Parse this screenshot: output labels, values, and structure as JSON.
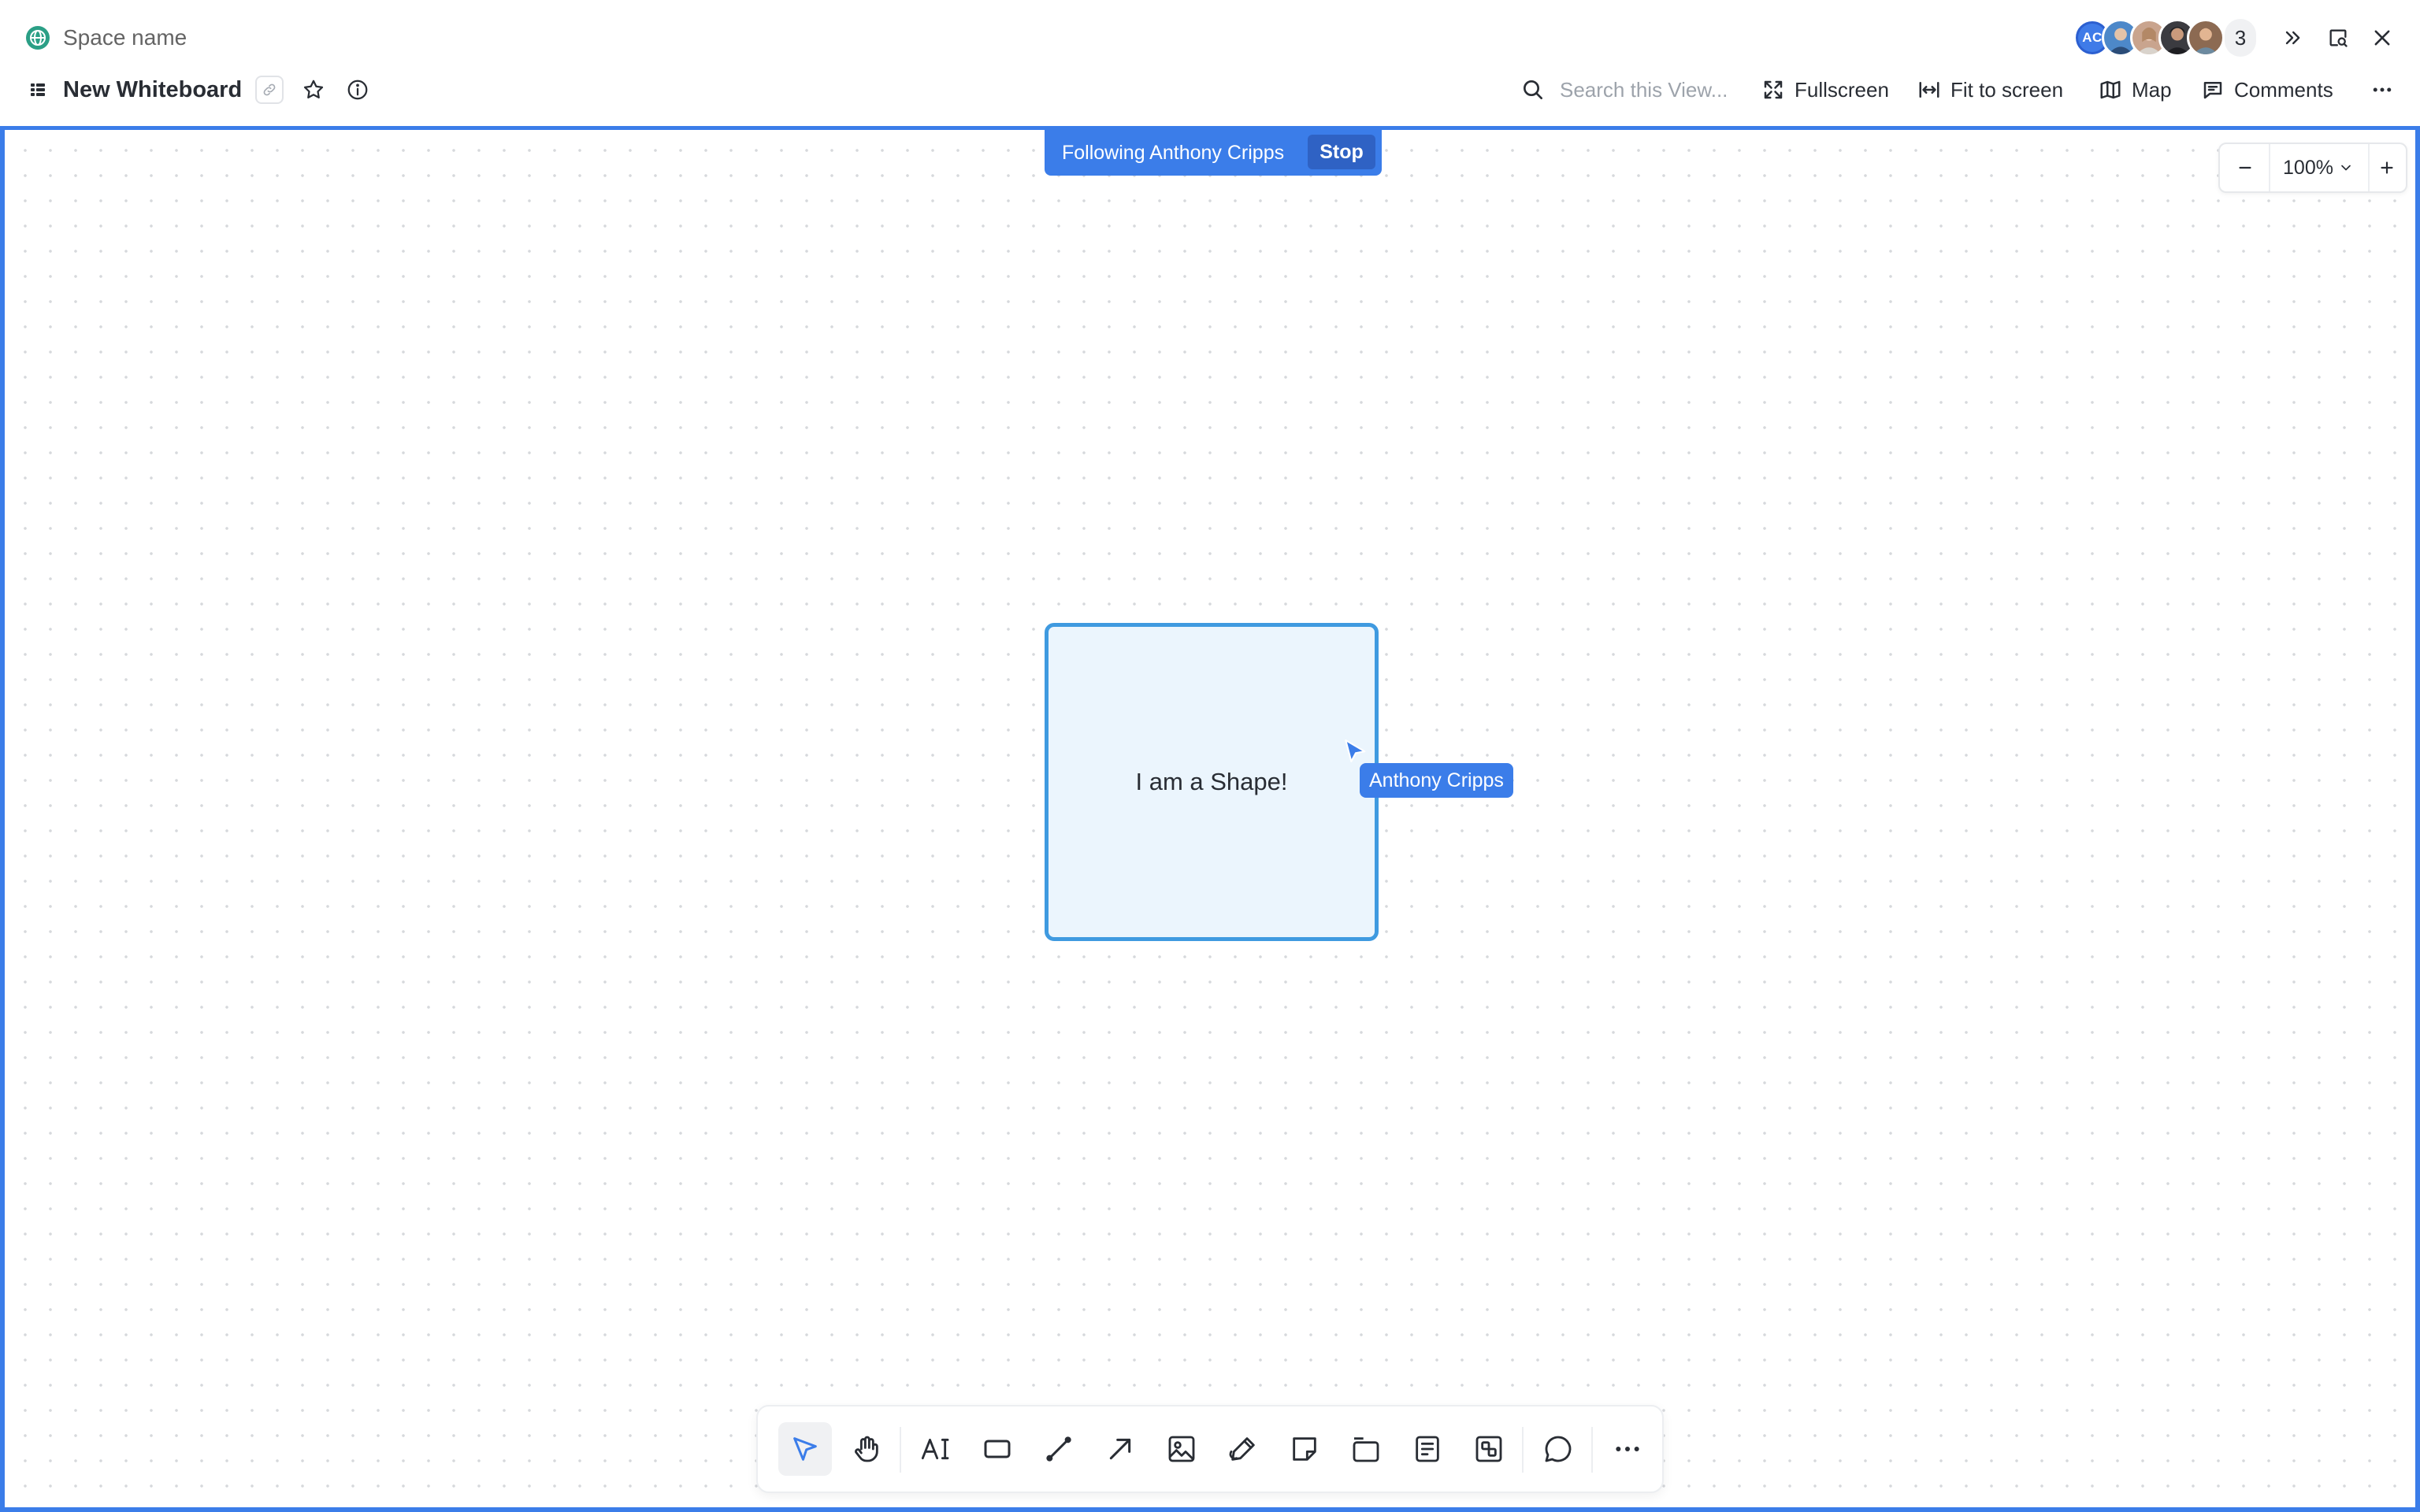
{
  "header": {
    "space_name": "Space name",
    "doc_title": "New Whiteboard",
    "avatars": [
      {
        "initials": "AC",
        "color": "#3f7be8"
      },
      {
        "initials": "",
        "color": "#4d88c9"
      },
      {
        "initials": "",
        "color": "#c9a48e"
      },
      {
        "initials": "",
        "color": "#3b3b40"
      },
      {
        "initials": "",
        "color": "#8c6a52"
      }
    ],
    "avatar_count": "3"
  },
  "toolbar": {
    "search_placeholder": "Search this View...",
    "fullscreen_label": "Fullscreen",
    "fit_label": "Fit to screen",
    "map_label": "Map",
    "comments_label": "Comments"
  },
  "canvas": {
    "follow_text": "Following Anthony Cripps",
    "stop_label": "Stop",
    "zoom_level": "100%",
    "shape_text": "I am a Shape!",
    "cursor_user": "Anthony Cripps",
    "accent_color": "#3b7de9",
    "shape_border_color": "#3f9ae0",
    "shape_fill_color": "#ebf5fd"
  },
  "bottom_tools": [
    {
      "name": "select-tool",
      "icon": "cursor-arrow-icon",
      "active": true
    },
    {
      "name": "hand-tool",
      "icon": "hand-icon"
    },
    {
      "name": "text-tool",
      "icon": "text-icon"
    },
    {
      "name": "rectangle-tool",
      "icon": "rectangle-icon"
    },
    {
      "name": "line-tool",
      "icon": "line-icon"
    },
    {
      "name": "arrow-tool",
      "icon": "arrow-icon"
    },
    {
      "name": "image-tool",
      "icon": "image-icon"
    },
    {
      "name": "pen-tool",
      "icon": "pen-icon"
    },
    {
      "name": "sticky-note-tool",
      "icon": "sticky-note-icon"
    },
    {
      "name": "frame-tool",
      "icon": "frame-icon"
    },
    {
      "name": "card-tool",
      "icon": "card-icon"
    },
    {
      "name": "embed-tool",
      "icon": "embed-icon"
    },
    {
      "name": "comment-tool",
      "icon": "comment-icon"
    },
    {
      "name": "more-tools",
      "icon": "more-icon"
    }
  ]
}
